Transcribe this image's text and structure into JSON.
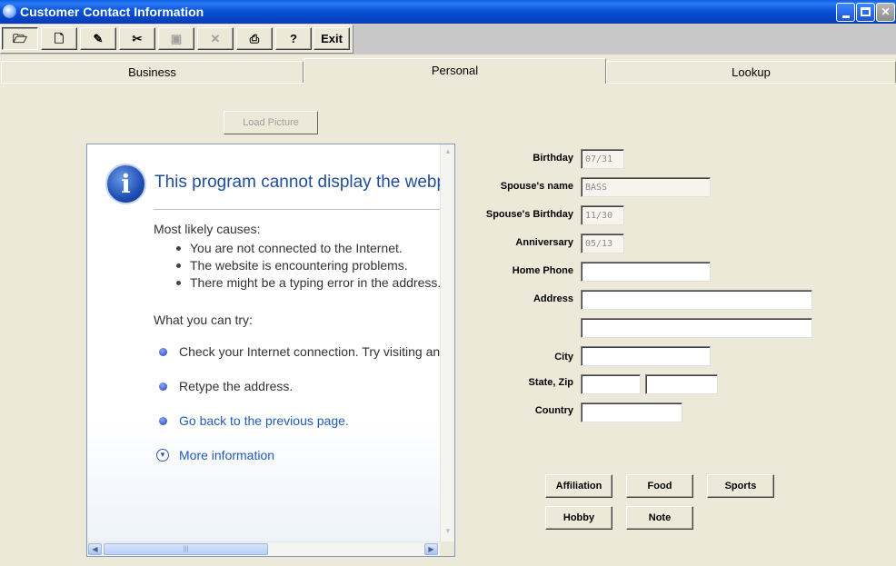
{
  "window": {
    "title": "Customer Contact Information"
  },
  "toolbar": {
    "buttons": [
      {
        "icon": "open-folder-icon",
        "glyph": "🗁"
      },
      {
        "icon": "new-document-icon",
        "glyph": "🗋"
      },
      {
        "icon": "edit-icon",
        "glyph": "✎"
      },
      {
        "icon": "cut-icon",
        "glyph": "✂"
      },
      {
        "icon": "save-icon",
        "glyph": "▣"
      },
      {
        "icon": "delete-icon",
        "glyph": "✕"
      },
      {
        "icon": "print-icon",
        "glyph": "⎙"
      },
      {
        "icon": "help-icon",
        "glyph": "?"
      }
    ],
    "exit_label": "Exit"
  },
  "tabs": [
    {
      "label": "Business"
    },
    {
      "label": "Personal"
    },
    {
      "label": "Lookup"
    }
  ],
  "load_picture_label": "Load Picture",
  "browser": {
    "title": "This program cannot display the webpage",
    "causes_heading": "Most likely causes:",
    "causes": [
      "You are not connected to the Internet.",
      "The website is encountering problems.",
      "There might be a typing error in the address."
    ],
    "try_heading": "What you can try:",
    "tries": [
      "Check your Internet connection. Try visiting another website to make sure you are connected.",
      "Retype the address.",
      "Go back to the previous page."
    ],
    "more_info": "More information"
  },
  "form": {
    "birthday": {
      "label": "Birthday",
      "value": "07/31"
    },
    "spouse_name": {
      "label": "Spouse's name",
      "value": "BASS"
    },
    "spouse_birthday": {
      "label": "Spouse's Birthday",
      "value": "11/30"
    },
    "anniversary": {
      "label": "Anniversary",
      "value": "05/13"
    },
    "home_phone": {
      "label": "Home Phone",
      "value": ""
    },
    "address": {
      "label": "Address",
      "value1": "",
      "value2": ""
    },
    "city": {
      "label": "City",
      "value": ""
    },
    "state_zip": {
      "label": "State, Zip",
      "state": "",
      "zip": ""
    },
    "country": {
      "label": "Country",
      "value": ""
    }
  },
  "buttons": {
    "affiliation": "Affiliation",
    "food": "Food",
    "sports": "Sports",
    "hobby": "Hobby",
    "note": "Note"
  }
}
